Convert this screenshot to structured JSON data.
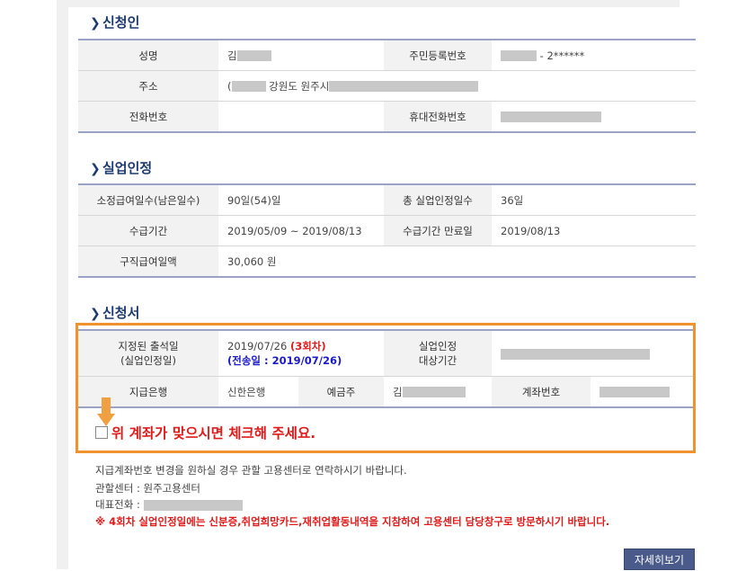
{
  "sections": {
    "applicant": {
      "title": "신청인",
      "name_label": "성명",
      "name_value": "김",
      "rrn_label": "주민등록번호",
      "rrn_value": "- 2******",
      "address_label": "주소",
      "address_prefix": "(",
      "address_value": "강원도 원주시",
      "phone_label": "전화번호",
      "phone_value": "",
      "mobile_label": "휴대전화번호"
    },
    "unemployment": {
      "title": "실업인정",
      "days_label": "소정급여일수(남은일수)",
      "days_value": "90일(54)일",
      "total_label": "총 실업인정일수",
      "total_value": "36일",
      "period_label": "수급기간",
      "period_value": "2019/05/09 ~ 2019/08/13",
      "expiry_label": "수급기간 만료일",
      "expiry_value": "2019/08/13",
      "amount_label": "구직급여일액",
      "amount_value": "30,060 원"
    },
    "application": {
      "title": "신청서",
      "date_label_1": "지정된 출석일",
      "date_label_2": "(실업인정일)",
      "date_value": "2019/07/26",
      "round": "(3회차)",
      "sent_date": "(전송일 : 2019/07/26)",
      "target_label_1": "실업인정",
      "target_label_2": "대상기간",
      "bank_label": "지급은행",
      "bank_value": "신한은행",
      "holder_label": "예금주",
      "holder_value": "김",
      "account_label": "계좌번호"
    }
  },
  "confirm": {
    "text": "위 계좌가 맞으시면 체크해 주세요.",
    "checked": false
  },
  "info": {
    "line1": "지급계좌번호 변경을 원하실 경우 관할 고용센터로 연락하시기 바랍니다.",
    "center_label": "관할센터 : 원주고용센터",
    "phone_label": "대표전화 :",
    "warning": "※ 4회차 실업인정일에는 신분증,취업희망카드,재취업활동내역을 지참하여 고용센터 담당창구로 방문하시기 바랍니다."
  },
  "buttons": {
    "details": "자세히보기"
  },
  "colors": {
    "highlight_border": "#f0922e",
    "title": "#1d3a6e",
    "warning": "#e01b1b",
    "sent_date": "#1a1ac8"
  }
}
